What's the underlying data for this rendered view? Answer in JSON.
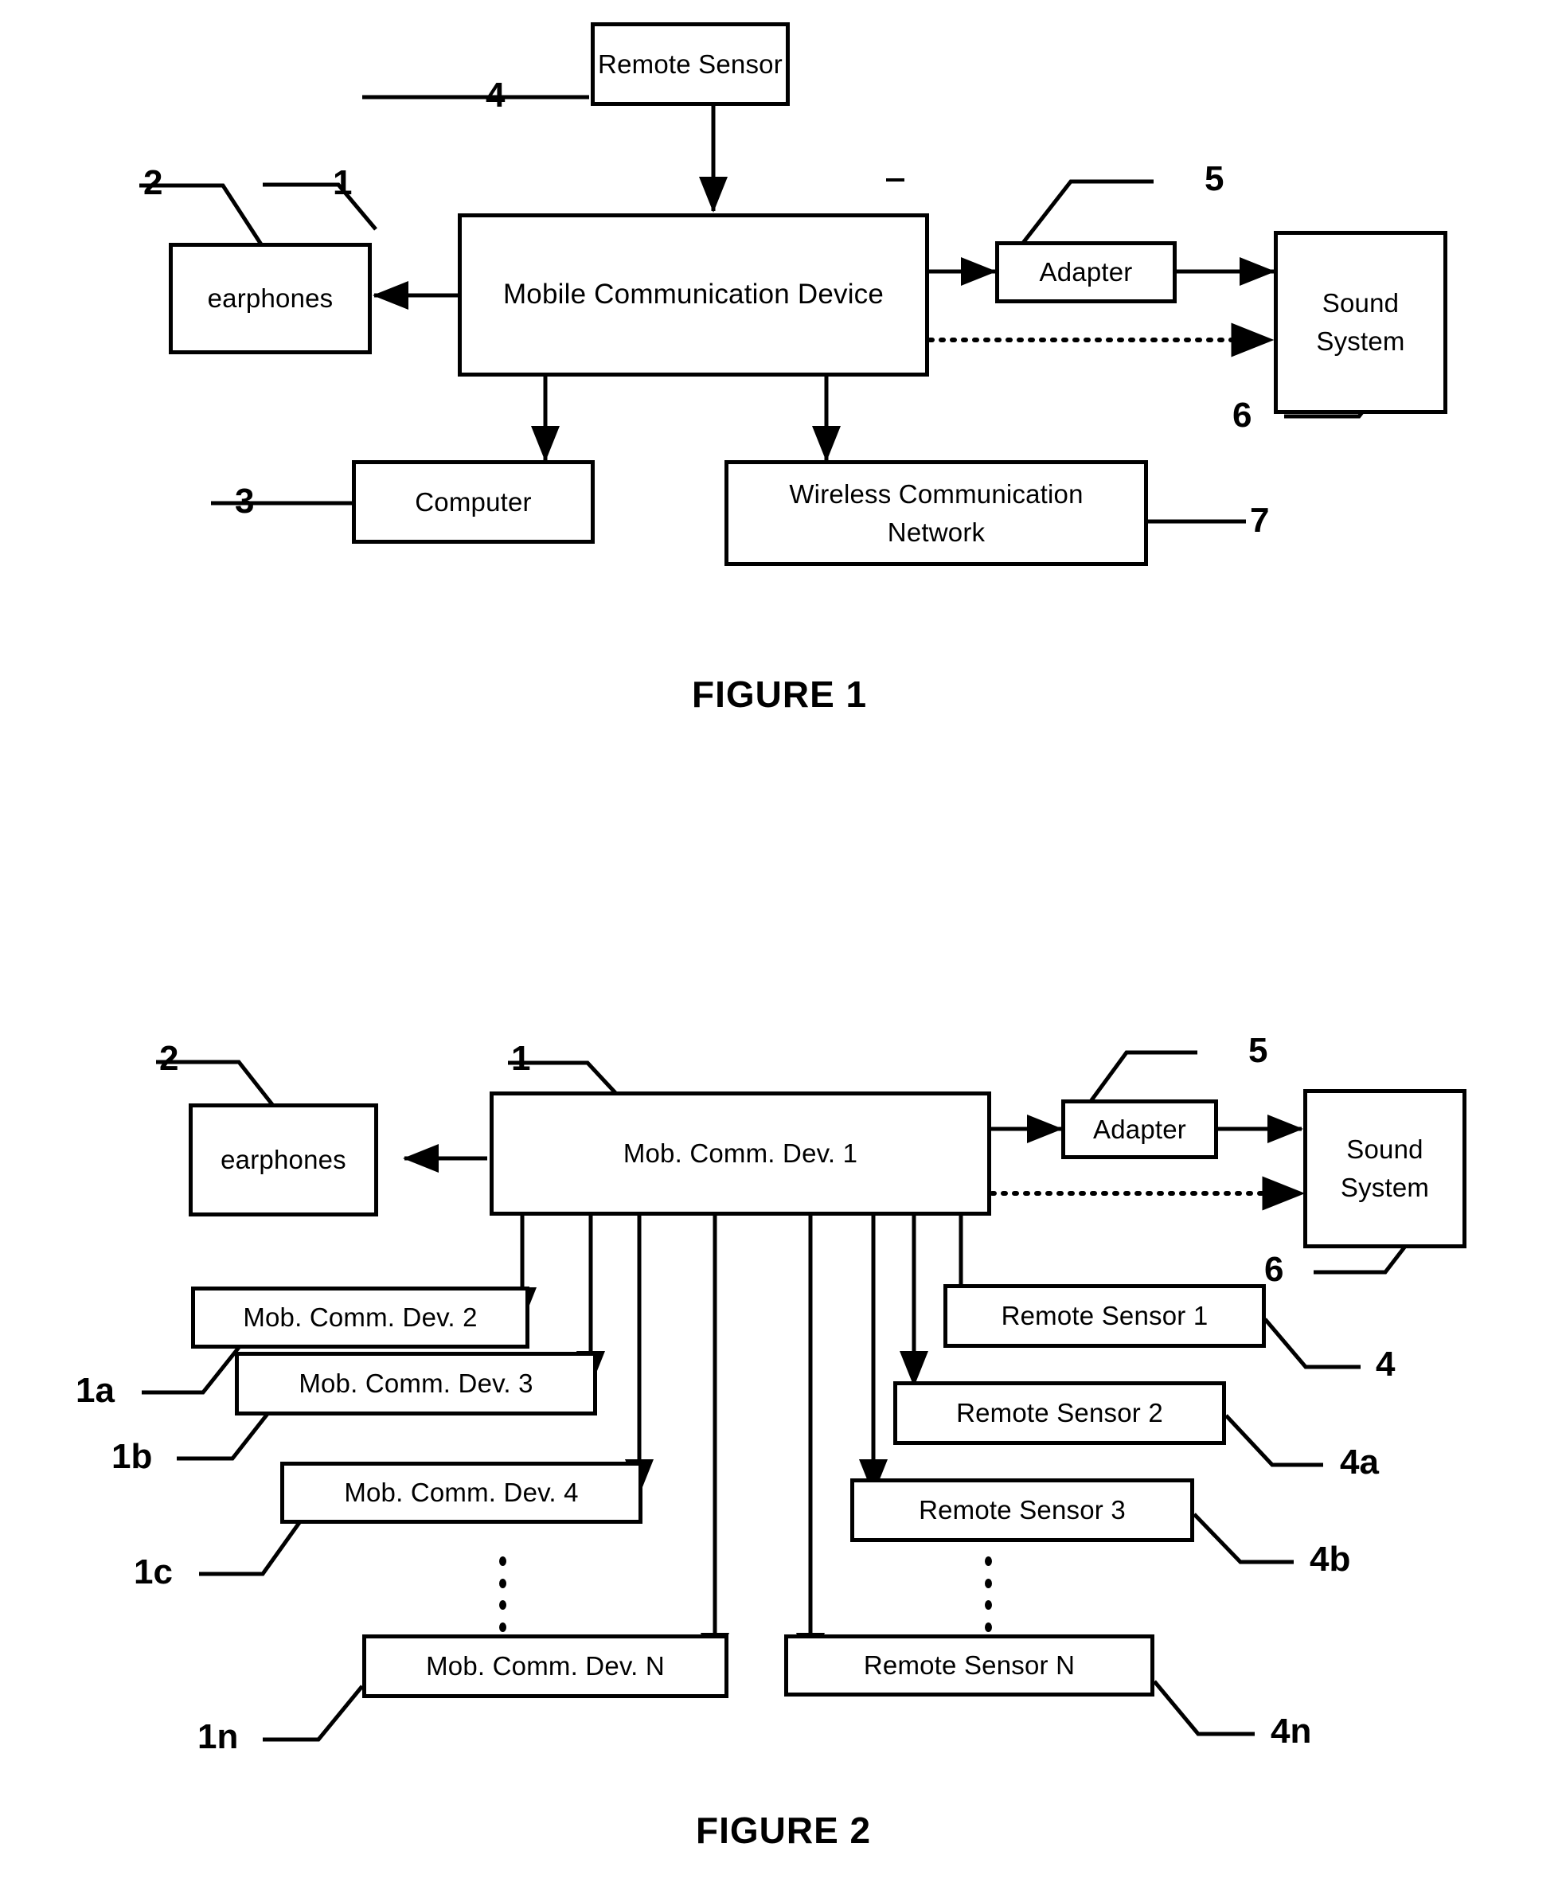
{
  "document": {
    "type": "patent-drawing-sheet",
    "figures": [
      {
        "caption": "FIGURE 1",
        "boxes": [
          {
            "id": "remote-sensor",
            "label": "Remote Sensor",
            "ref": "4"
          },
          {
            "id": "mobile-communication-device",
            "label": "Mobile Communication Device",
            "ref": "1"
          },
          {
            "id": "earphones",
            "label": "earphones",
            "ref": "2"
          },
          {
            "id": "adapter",
            "label": "Adapter",
            "ref": "5"
          },
          {
            "id": "sound-system",
            "label": "Sound System",
            "ref": "6"
          },
          {
            "id": "computer",
            "label": "Computer",
            "ref": "3"
          },
          {
            "id": "wireless-communication-network",
            "label": "Wireless Communication Network",
            "ref": "7"
          }
        ],
        "reference_numerals": [
          "1",
          "2",
          "3",
          "4",
          "5",
          "6",
          "7"
        ],
        "connections": [
          {
            "from": "mobile-communication-device",
            "to": "remote-sensor",
            "style": "solid",
            "arrow": "double"
          },
          {
            "from": "mobile-communication-device",
            "to": "earphones",
            "style": "solid",
            "arrow": "single"
          },
          {
            "from": "mobile-communication-device",
            "to": "adapter",
            "style": "solid",
            "arrow": "single"
          },
          {
            "from": "adapter",
            "to": "sound-system",
            "style": "solid",
            "arrow": "single"
          },
          {
            "from": "mobile-communication-device",
            "to": "sound-system",
            "style": "dotted",
            "arrow": "single"
          },
          {
            "from": "mobile-communication-device",
            "to": "computer",
            "style": "solid",
            "arrow": "double"
          },
          {
            "from": "mobile-communication-device",
            "to": "wireless-communication-network",
            "style": "solid",
            "arrow": "double"
          }
        ]
      },
      {
        "caption": "FIGURE 2",
        "boxes": [
          {
            "id": "mob-comm-dev-1",
            "label": "Mob. Comm. Dev. 1",
            "ref": "1"
          },
          {
            "id": "earphones-2",
            "label": "earphones",
            "ref": "2"
          },
          {
            "id": "adapter-2",
            "label": "Adapter",
            "ref": "5"
          },
          {
            "id": "sound-system-2",
            "label": "Sound System",
            "ref": "6"
          },
          {
            "id": "mob-comm-dev-2",
            "label": "Mob. Comm. Dev. 2",
            "ref": "1a"
          },
          {
            "id": "mob-comm-dev-3",
            "label": "Mob. Comm. Dev. 3",
            "ref": "1b"
          },
          {
            "id": "mob-comm-dev-4",
            "label": "Mob. Comm. Dev. 4",
            "ref": "1c"
          },
          {
            "id": "mob-comm-dev-n",
            "label": "Mob. Comm. Dev. N",
            "ref": "1n"
          },
          {
            "id": "remote-sensor-1",
            "label": "Remote Sensor 1",
            "ref": "4"
          },
          {
            "id": "remote-sensor-2",
            "label": "Remote Sensor 2",
            "ref": "4a"
          },
          {
            "id": "remote-sensor-3",
            "label": "Remote Sensor 3",
            "ref": "4b"
          },
          {
            "id": "remote-sensor-n",
            "label": "Remote Sensor N",
            "ref": "4n"
          }
        ],
        "reference_numerals": [
          "1",
          "1a",
          "1b",
          "1c",
          "1n",
          "2",
          "4",
          "4a",
          "4b",
          "4n",
          "5",
          "6"
        ],
        "ellipses": [
          "vertical-ellipsis-left",
          "vertical-ellipsis-right"
        ],
        "connections": [
          {
            "from": "mob-comm-dev-1",
            "to": "earphones-2",
            "style": "solid",
            "arrow": "single"
          },
          {
            "from": "mob-comm-dev-1",
            "to": "adapter-2",
            "style": "solid",
            "arrow": "single"
          },
          {
            "from": "adapter-2",
            "to": "sound-system-2",
            "style": "solid",
            "arrow": "single"
          },
          {
            "from": "mob-comm-dev-1",
            "to": "sound-system-2",
            "style": "dotted",
            "arrow": "single"
          },
          {
            "from": "mob-comm-dev-1",
            "to": "mob-comm-dev-2",
            "style": "solid",
            "arrow": "double"
          },
          {
            "from": "mob-comm-dev-1",
            "to": "mob-comm-dev-3",
            "style": "solid",
            "arrow": "double"
          },
          {
            "from": "mob-comm-dev-1",
            "to": "mob-comm-dev-4",
            "style": "solid",
            "arrow": "double"
          },
          {
            "from": "mob-comm-dev-1",
            "to": "mob-comm-dev-n",
            "style": "solid",
            "arrow": "double"
          },
          {
            "from": "mob-comm-dev-1",
            "to": "remote-sensor-1",
            "style": "solid",
            "arrow": "double"
          },
          {
            "from": "mob-comm-dev-1",
            "to": "remote-sensor-2",
            "style": "solid",
            "arrow": "double"
          },
          {
            "from": "mob-comm-dev-1",
            "to": "remote-sensor-3",
            "style": "solid",
            "arrow": "double"
          },
          {
            "from": "mob-comm-dev-1",
            "to": "remote-sensor-n",
            "style": "solid",
            "arrow": "double"
          }
        ]
      }
    ]
  },
  "fig1": {
    "caption": "FIGURE 1",
    "remote_sensor": "Remote Sensor",
    "mobile_device": "Mobile Communication Device",
    "earphones": "earphones",
    "adapter": "Adapter",
    "sound_system": "Sound System",
    "computer": "Computer",
    "network": "Wireless Communication Network",
    "ref1": "1",
    "ref2": "2",
    "ref3": "3",
    "ref4": "4",
    "ref5": "5",
    "ref6": "6",
    "ref7": "7"
  },
  "fig2": {
    "caption": "FIGURE 2",
    "mcd1": "Mob. Comm. Dev. 1",
    "mcd2": "Mob. Comm. Dev. 2",
    "mcd3": "Mob. Comm. Dev. 3",
    "mcd4": "Mob. Comm. Dev. 4",
    "mcdn": "Mob. Comm. Dev. N",
    "rs1": "Remote Sensor 1",
    "rs2": "Remote Sensor 2",
    "rs3": "Remote Sensor 3",
    "rsn": "Remote Sensor N",
    "earphones": "earphones",
    "adapter": "Adapter",
    "sound_system": "Sound System",
    "ref1": "1",
    "ref1a": "1a",
    "ref1b": "1b",
    "ref1c": "1c",
    "ref1n": "1n",
    "ref2": "2",
    "ref4": "4",
    "ref4a": "4a",
    "ref4b": "4b",
    "ref4n": "4n",
    "ref5": "5",
    "ref6": "6"
  }
}
